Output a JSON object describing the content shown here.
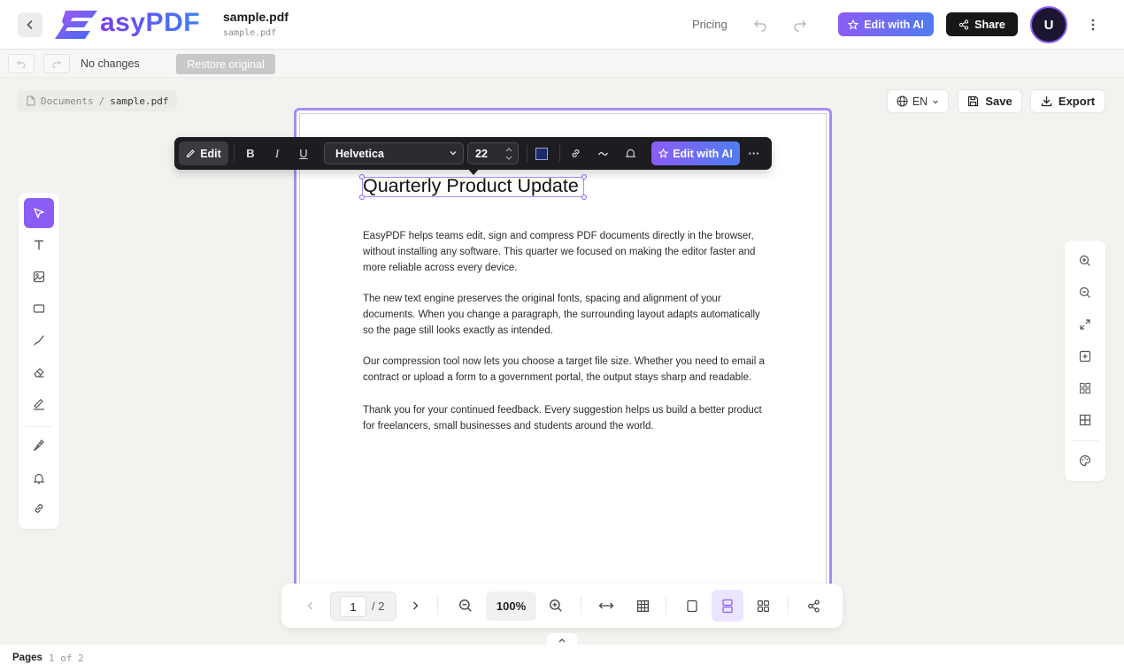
{
  "app": {
    "logo_text": "asyPDF",
    "pricing_label": "Pricing",
    "edit_ai_label": "Edit with AI",
    "share_label": "Share",
    "avatar_initial": "U",
    "accent_color": "#8b5cf6"
  },
  "file": {
    "name": "sample.pdf",
    "subtitle": "sample.pdf"
  },
  "subbar": {
    "status": "No changes",
    "restore_label": "Restore original"
  },
  "breadcrumb": {
    "root": "Documents",
    "separator": "/",
    "current": "sample.pdf"
  },
  "actions": {
    "language": "EN",
    "save_label": "Save",
    "export_label": "Export"
  },
  "tools": [
    "select-icon",
    "text-icon",
    "image-icon",
    "rectangle-icon",
    "draw-icon",
    "eraser-icon",
    "signature-icon",
    "pen-icon",
    "bell-icon",
    "link-icon"
  ],
  "format_toolbar": {
    "edit_label": "Edit",
    "bold": "B",
    "italic": "I",
    "underline": "U",
    "font": "Helvetica",
    "size": "22",
    "text_color": "#1b2a6b",
    "ai_label": "Edit with AI",
    "more": "···"
  },
  "document": {
    "title": "Quarterly Product Update",
    "paragraphs": [
      "EasyPDF helps teams edit, sign and compress PDF documents directly in the browser, without installing any software. This quarter we focused on making the editor faster and more reliable across every device.",
      "The new text engine preserves the original fonts, spacing and alignment of your documents. When you change a paragraph, the surrounding layout adapts automatically so the page still looks exactly as intended.",
      "Our compression tool now lets you choose a target file size. Whether you need to email a contract or upload a form to a government portal, the output stays sharp and readable.",
      "Thank you for your continued feedback. Every suggestion helps us build a better product for freelancers, small businesses and students around the world."
    ]
  },
  "pager": {
    "current_page": "1",
    "total": "/ 2",
    "zoom": "100%"
  },
  "footer": {
    "label": "Pages",
    "count": "1 of 2"
  }
}
